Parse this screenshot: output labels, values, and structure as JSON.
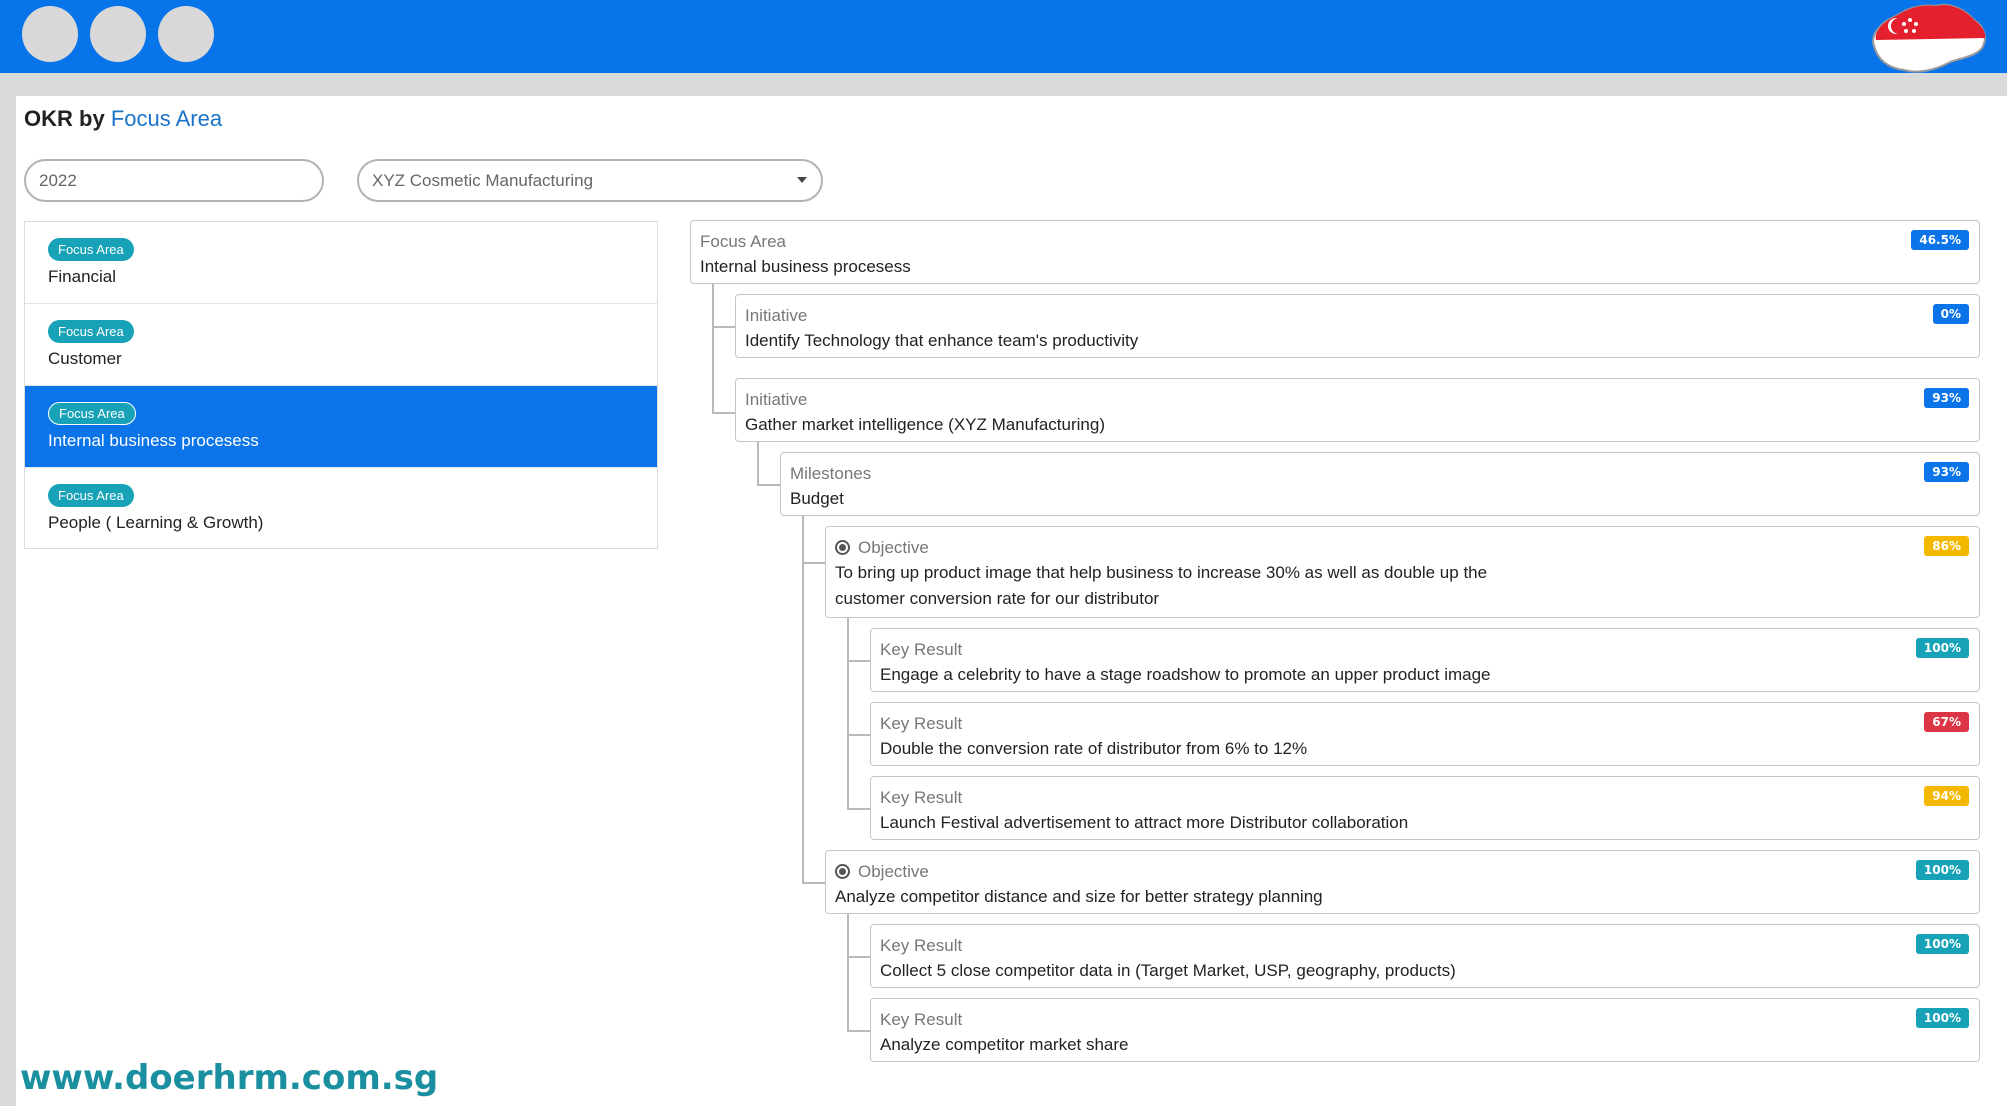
{
  "window": {
    "dots": 3,
    "colors": {
      "topbar": "#0874ea",
      "accent": "#1a73c9",
      "active": "#0b74e8",
      "badge_teal": "#17a2b8"
    }
  },
  "page_title": {
    "prefix": "OKR by",
    "accent": "Focus Area"
  },
  "filters": {
    "year": "2022",
    "company": "XYZ Cosmetic Manufacturing"
  },
  "sidebar": {
    "items": [
      {
        "badge": "Focus Area",
        "label": "Financial",
        "active": false
      },
      {
        "badge": "Focus Area",
        "label": "Customer",
        "active": false
      },
      {
        "badge": "Focus Area",
        "label": "Internal business procesess",
        "active": true
      },
      {
        "badge": "Focus Area",
        "label": "People ( Learning & Growth)",
        "active": false
      }
    ]
  },
  "tree": [
    {
      "type": "Focus Area",
      "text": "Internal business procesess",
      "percent": "46.5%",
      "color": "#0b74e8",
      "icon": ""
    },
    {
      "type": "Initiative",
      "text": "Identify Technology that enhance team's productivity",
      "percent": "0%",
      "color": "#0b74e8",
      "icon": ""
    },
    {
      "type": "Initiative",
      "text": "Gather market intelligence (XYZ Manufacturing)",
      "percent": "93%",
      "color": "#0b74e8",
      "icon": ""
    },
    {
      "type": "Milestones",
      "text": "Budget",
      "percent": "93%",
      "color": "#0b74e8",
      "icon": ""
    },
    {
      "type": "Objective",
      "text": "To bring up product image that help business to increase 30% as well as double up the customer conversion rate for our distributor",
      "percent": "86%",
      "color": "#f5b800",
      "icon": "target-icon"
    },
    {
      "type": "Key Result",
      "text": "Engage a celebrity to have a stage roadshow to promote an upper product image",
      "percent": "100%",
      "color": "#17a2b8",
      "icon": ""
    },
    {
      "type": "Key Result",
      "text": "Double the conversion rate of distributor from 6% to 12%",
      "percent": "67%",
      "color": "#dc3545",
      "icon": ""
    },
    {
      "type": "Key Result",
      "text": "Launch Festival advertisement to attract more Distributor collaboration",
      "percent": "94%",
      "color": "#f5b800",
      "icon": ""
    },
    {
      "type": "Objective",
      "text": "Analyze competitor distance and size for better strategy planning",
      "percent": "100%",
      "color": "#17a2b8",
      "icon": "target-icon"
    },
    {
      "type": "Key Result",
      "text": "Collect 5 close competitor data in (Target Market, USP, geography, products)",
      "percent": "100%",
      "color": "#17a2b8",
      "icon": ""
    },
    {
      "type": "Key Result",
      "text": "Analyze competitor market share",
      "percent": "100%",
      "color": "#17a2b8",
      "icon": ""
    }
  ],
  "watermark": "www.doerhrm.com.sg"
}
